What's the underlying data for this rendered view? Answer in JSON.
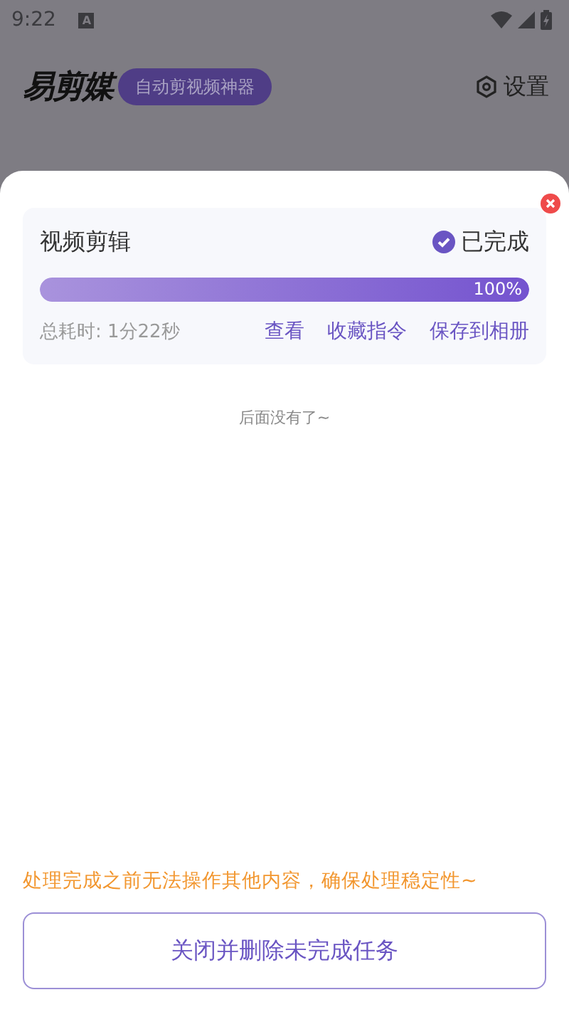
{
  "status_bar": {
    "time": "9:22",
    "notification": "A"
  },
  "header": {
    "logo": "易剪媒",
    "tagline": "自动剪视频神器",
    "settings": "设置"
  },
  "tasks": [
    {
      "title": "视频剪辑",
      "status": "已完成",
      "done": true,
      "level": 1,
      "percent": "100%",
      "elapsed": "总耗时: 1分22秒",
      "actions": [
        "查看",
        "收藏指令",
        "保存到相册"
      ]
    }
  ],
  "end_note": "后面没有了~",
  "warning": "处理完成之前无法操作其他内容，确保处理稳定性~",
  "close_button": "关闭并删除未完成任务"
}
